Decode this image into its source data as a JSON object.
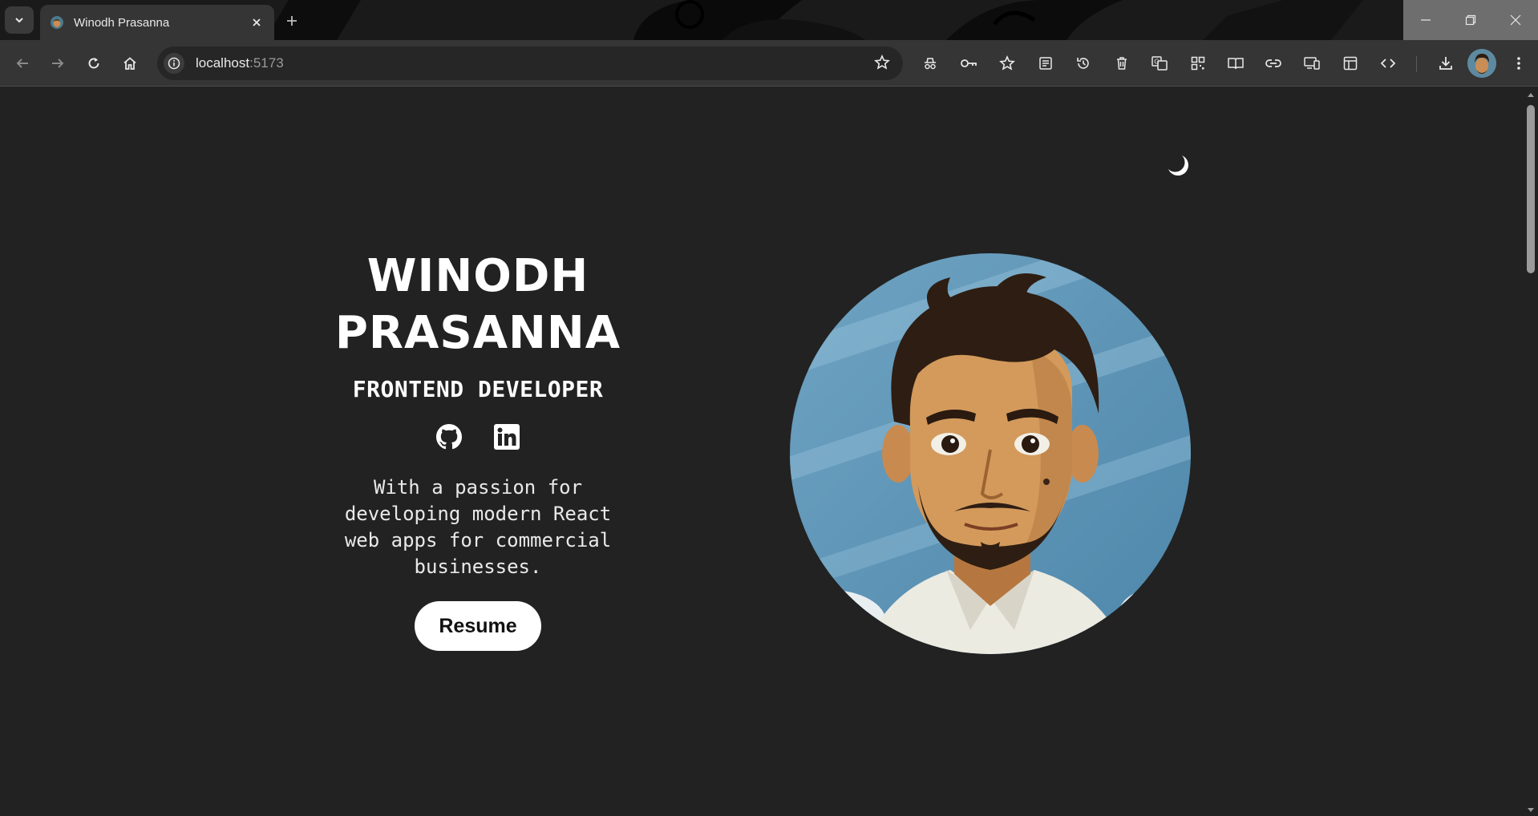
{
  "browser": {
    "tab_title": "Winodh Prasanna",
    "url_host": "localhost",
    "url_port": ":5173"
  },
  "hero": {
    "name_line1": "WINODH",
    "name_line2": "PRASANNA",
    "role": "FRONTEND DEVELOPER",
    "description": "With a passion for developing modern React web apps for commercial businesses.",
    "resume_label": "Resume",
    "socials": [
      {
        "icon": "github-icon"
      },
      {
        "icon": "linkedin-icon"
      }
    ]
  },
  "colors": {
    "page_bg": "#222222",
    "text": "#ffffff",
    "button_bg": "#ffffff",
    "button_text": "#111111",
    "chrome_bg": "#353535"
  }
}
